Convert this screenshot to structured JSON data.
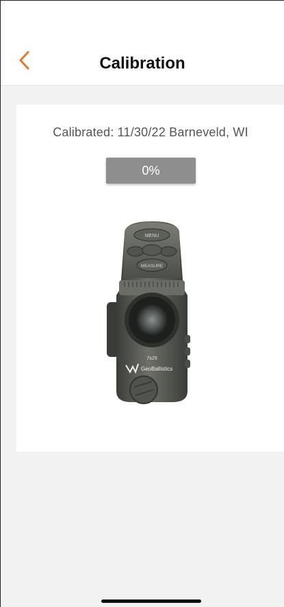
{
  "header": {
    "title": "Calibration",
    "back_icon": "chevron-left-icon",
    "accent_color": "#E07B2A"
  },
  "calibration": {
    "status_text": "Calibrated: 11/30/22 Barneveld, WI",
    "progress_label": "0%",
    "progress_value": 0
  },
  "device": {
    "menu_label": "MENU",
    "measure_label": "MEASURE",
    "model_label": "7x25",
    "brand_label": "GeoBallistics"
  }
}
